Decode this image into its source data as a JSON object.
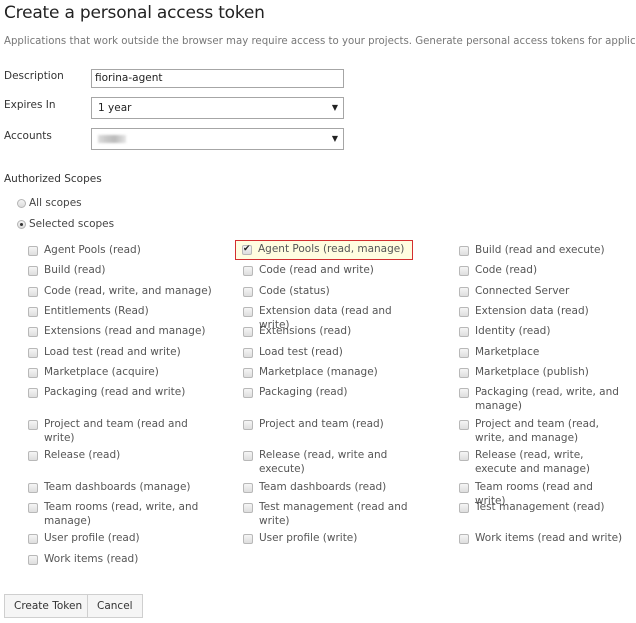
{
  "page": {
    "title": "Create a personal access token",
    "subtitle": "Applications that work outside the browser may require access to your projects. Generate personal access tokens for applications that require"
  },
  "form": {
    "description": {
      "label": "Description",
      "value": "fiorina-agent"
    },
    "expires": {
      "label": "Expires In",
      "value": "1 year"
    },
    "accounts": {
      "label": "Accounts",
      "value": ""
    }
  },
  "scopes": {
    "label": "Authorized Scopes",
    "all_label": "All scopes",
    "selected_label": "Selected scopes",
    "mode": "selected",
    "items": [
      {
        "label": "Agent Pools (read)",
        "checked": false,
        "col": 0,
        "row": 0
      },
      {
        "label": "Agent Pools (read, manage)",
        "checked": true,
        "col": 1,
        "row": 0,
        "highlighted": true
      },
      {
        "label": "Build (read and execute)",
        "checked": false,
        "col": 2,
        "row": 0
      },
      {
        "label": "Build (read)",
        "checked": false,
        "col": 0,
        "row": 1
      },
      {
        "label": "Code (read and write)",
        "checked": false,
        "col": 1,
        "row": 1
      },
      {
        "label": "Code (read)",
        "checked": false,
        "col": 2,
        "row": 1
      },
      {
        "label": "Code (read, write, and manage)",
        "checked": false,
        "col": 0,
        "row": 2
      },
      {
        "label": "Code (status)",
        "checked": false,
        "col": 1,
        "row": 2
      },
      {
        "label": "Connected Server",
        "checked": false,
        "col": 2,
        "row": 2
      },
      {
        "label": "Entitlements (Read)",
        "checked": false,
        "col": 0,
        "row": 3
      },
      {
        "label": "Extension data (read and write)",
        "checked": false,
        "col": 1,
        "row": 3
      },
      {
        "label": "Extension data (read)",
        "checked": false,
        "col": 2,
        "row": 3
      },
      {
        "label": "Extensions (read and manage)",
        "checked": false,
        "col": 0,
        "row": 4
      },
      {
        "label": "Extensions (read)",
        "checked": false,
        "col": 1,
        "row": 4
      },
      {
        "label": "Identity (read)",
        "checked": false,
        "col": 2,
        "row": 4
      },
      {
        "label": "Load test (read and write)",
        "checked": false,
        "col": 0,
        "row": 5
      },
      {
        "label": "Load test (read)",
        "checked": false,
        "col": 1,
        "row": 5
      },
      {
        "label": "Marketplace",
        "checked": false,
        "col": 2,
        "row": 5
      },
      {
        "label": "Marketplace (acquire)",
        "checked": false,
        "col": 0,
        "row": 6
      },
      {
        "label": "Marketplace (manage)",
        "checked": false,
        "col": 1,
        "row": 6
      },
      {
        "label": "Marketplace (publish)",
        "checked": false,
        "col": 2,
        "row": 6
      },
      {
        "label": "Packaging (read and write)",
        "checked": false,
        "col": 0,
        "row": 7
      },
      {
        "label": "Packaging (read)",
        "checked": false,
        "col": 1,
        "row": 7
      },
      {
        "label": "Packaging (read, write, and manage)",
        "checked": false,
        "col": 2,
        "row": 7
      },
      {
        "label": "Project and team (read and write)",
        "checked": false,
        "col": 0,
        "row": 8
      },
      {
        "label": "Project and team (read)",
        "checked": false,
        "col": 1,
        "row": 8
      },
      {
        "label": "Project and team (read, write, and manage)",
        "checked": false,
        "col": 2,
        "row": 8
      },
      {
        "label": "Release (read)",
        "checked": false,
        "col": 0,
        "row": 9
      },
      {
        "label": "Release (read, write and execute)",
        "checked": false,
        "col": 1,
        "row": 9
      },
      {
        "label": "Release (read, write, execute and manage)",
        "checked": false,
        "col": 2,
        "row": 9
      },
      {
        "label": "Team dashboards (manage)",
        "checked": false,
        "col": 0,
        "row": 10
      },
      {
        "label": "Team dashboards (read)",
        "checked": false,
        "col": 1,
        "row": 10
      },
      {
        "label": "Team rooms (read and write)",
        "checked": false,
        "col": 2,
        "row": 10
      },
      {
        "label": "Team rooms (read, write, and manage)",
        "checked": false,
        "col": 0,
        "row": 11
      },
      {
        "label": "Test management (read and write)",
        "checked": false,
        "col": 1,
        "row": 11
      },
      {
        "label": "Test management (read)",
        "checked": false,
        "col": 2,
        "row": 11
      },
      {
        "label": "User profile (read)",
        "checked": false,
        "col": 0,
        "row": 12
      },
      {
        "label": "User profile (write)",
        "checked": false,
        "col": 1,
        "row": 12
      },
      {
        "label": "Work items (read and write)",
        "checked": false,
        "col": 2,
        "row": 12
      },
      {
        "label": "Work items (read)",
        "checked": false,
        "col": 0,
        "row": 13
      }
    ]
  },
  "actions": {
    "create_label": "Create Token",
    "cancel_label": "Cancel"
  },
  "colors": {
    "highlight_border": "#d32f2f",
    "highlight_bg": "#fffde0"
  }
}
